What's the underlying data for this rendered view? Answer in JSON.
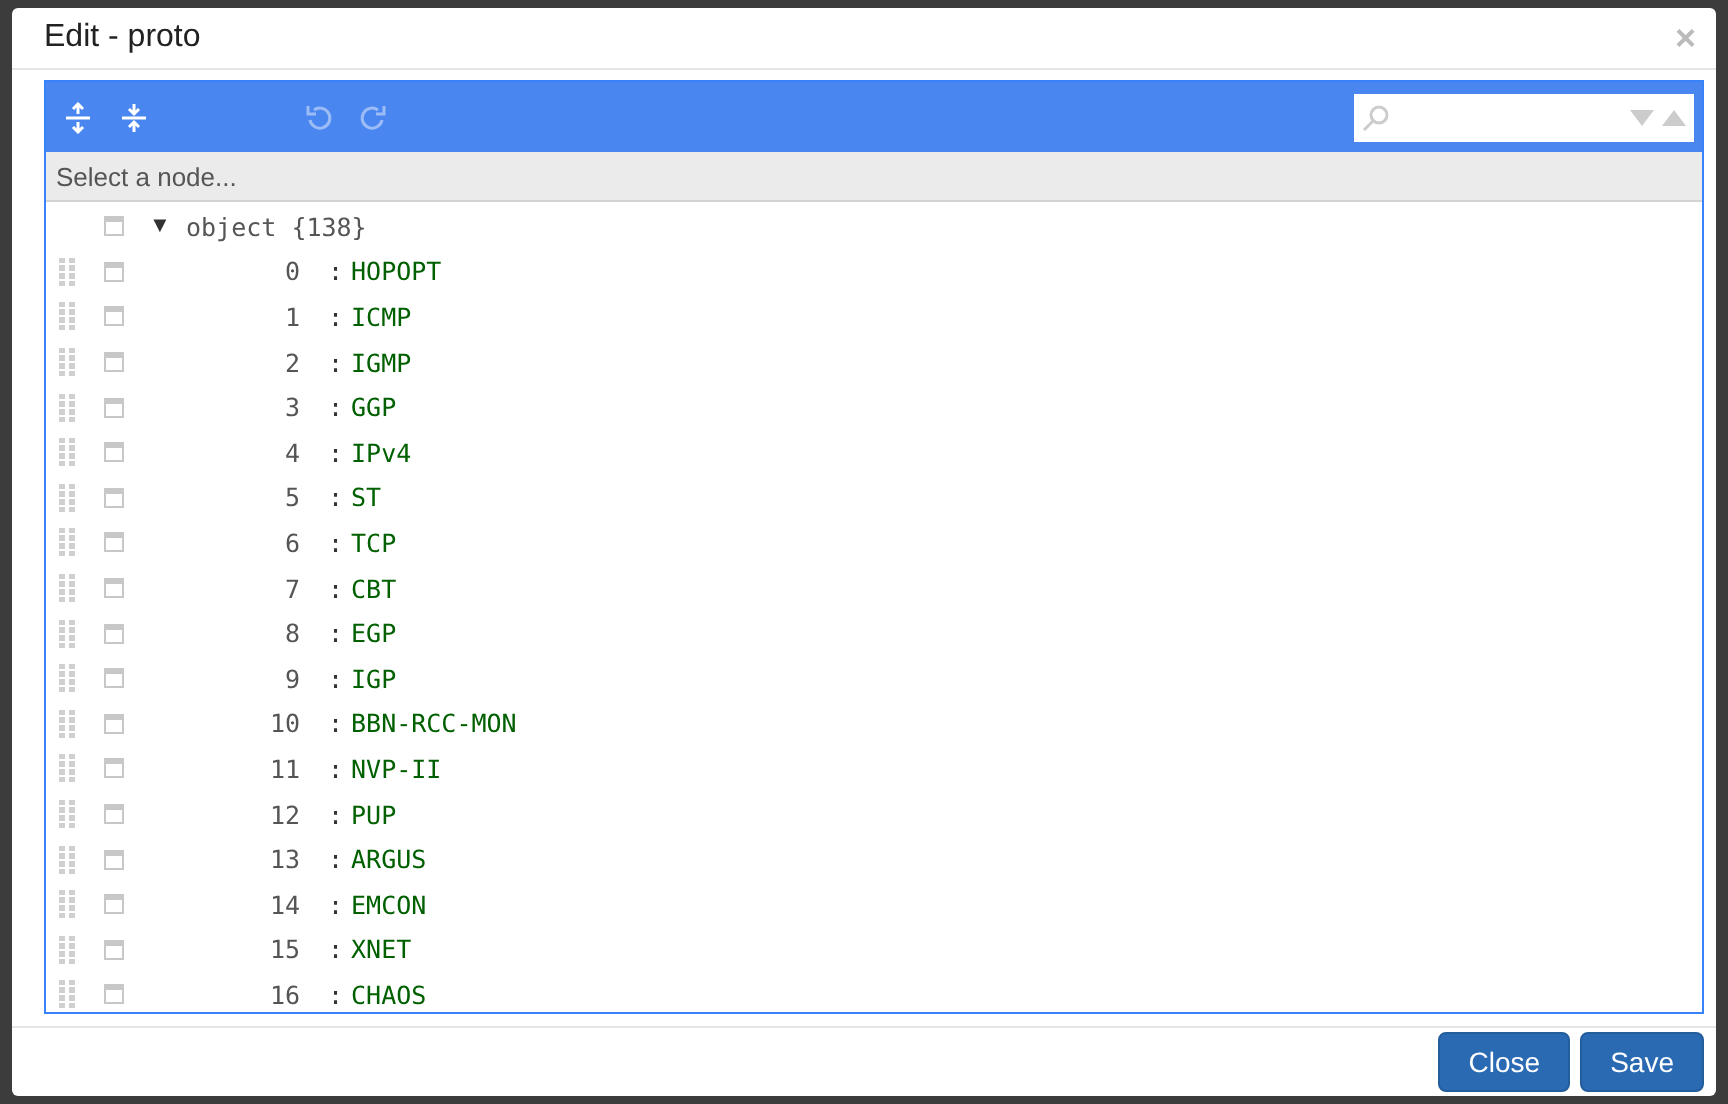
{
  "dialog": {
    "title": "Edit - proto",
    "close_symbol": "×"
  },
  "editor": {
    "navigation": "Select a node...",
    "root": {
      "toggle": "▼",
      "label": "object",
      "count": "{138}",
      "expanded": true,
      "selected": false
    },
    "separator": ":",
    "items": [
      {
        "key": "0",
        "value": "HOPOPT",
        "selected": false
      },
      {
        "key": "1",
        "value": "ICMP",
        "selected": false
      },
      {
        "key": "2",
        "value": "IGMP",
        "selected": false
      },
      {
        "key": "3",
        "value": "GGP",
        "selected": false
      },
      {
        "key": "4",
        "value": "IPv4",
        "selected": false
      },
      {
        "key": "5",
        "value": "ST",
        "selected": false
      },
      {
        "key": "6",
        "value": "TCP",
        "selected": false
      },
      {
        "key": "7",
        "value": "CBT",
        "selected": false
      },
      {
        "key": "8",
        "value": "EGP",
        "selected": false
      },
      {
        "key": "9",
        "value": "IGP",
        "selected": false
      },
      {
        "key": "10",
        "value": "BBN-RCC-MON",
        "selected": false
      },
      {
        "key": "11",
        "value": "NVP-II",
        "selected": false
      },
      {
        "key": "12",
        "value": "PUP",
        "selected": false
      },
      {
        "key": "13",
        "value": "ARGUS",
        "selected": false
      },
      {
        "key": "14",
        "value": "EMCON",
        "selected": false
      },
      {
        "key": "15",
        "value": "XNET",
        "selected": false
      },
      {
        "key": "16",
        "value": "CHAOS",
        "selected": false
      }
    ]
  },
  "buttons": [
    "Close",
    "Save"
  ]
}
